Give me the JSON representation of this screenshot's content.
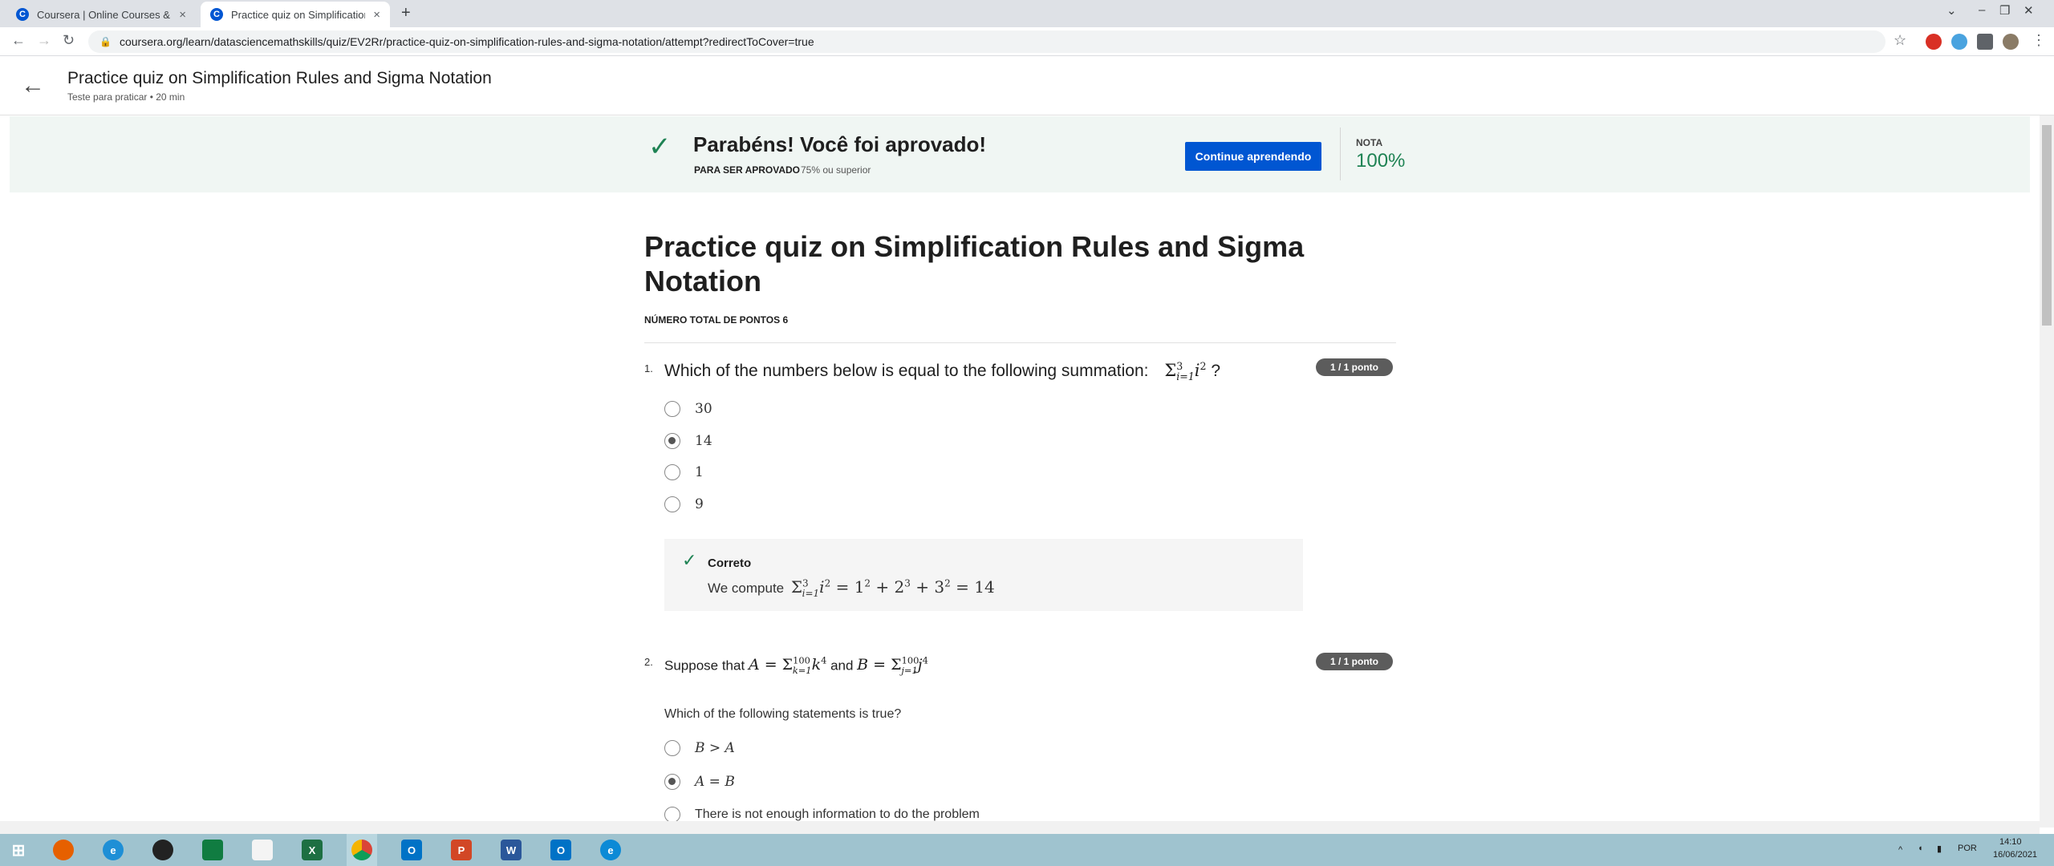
{
  "browser": {
    "tabs": [
      {
        "title": "Coursera | Online Courses & Cre",
        "active": false
      },
      {
        "title": "Practice quiz on Simplification R",
        "active": true
      }
    ],
    "new_tab": "+",
    "url": "coursera.org/learn/datasciencemathskills/quiz/EV2Rr/practice-quiz-on-simplification-rules-and-sigma-notation/attempt?redirectToCover=true"
  },
  "header": {
    "title": "Practice quiz on Simplification Rules and Sigma Notation",
    "subtitle": "Teste para praticar • 20 min"
  },
  "banner": {
    "title": "Parabéns! Você foi aprovado!",
    "pass_label": "PARA SER APROVADO",
    "pass_value": "75% ou superior",
    "button": "Continue aprendendo",
    "grade_label": "NOTA",
    "grade_value": "100%"
  },
  "quiz": {
    "heading": "Practice quiz on Simplification Rules and Sigma Notation",
    "total_points": "NÚMERO TOTAL DE PONTOS 6",
    "questions": [
      {
        "number": "1.",
        "text": "Which of the numbers below is equal to the following summation:",
        "badge": "1 / 1 ponto",
        "options": [
          "30",
          "14",
          "1",
          "9"
        ],
        "selected_index": 1,
        "feedback_label": "Correto",
        "feedback_text": "We compute"
      },
      {
        "number": "2.",
        "text_a": "Suppose that",
        "text_and": "and",
        "badge": "1 / 1 ponto",
        "prompt": "Which of the following statements is true?",
        "options": [
          "B > A",
          "A = B",
          "There is not enough information to do the problem"
        ],
        "selected_index": 1
      }
    ]
  },
  "taskbar": {
    "lang": "POR",
    "time": "14:10",
    "date": "16/06/2021"
  }
}
